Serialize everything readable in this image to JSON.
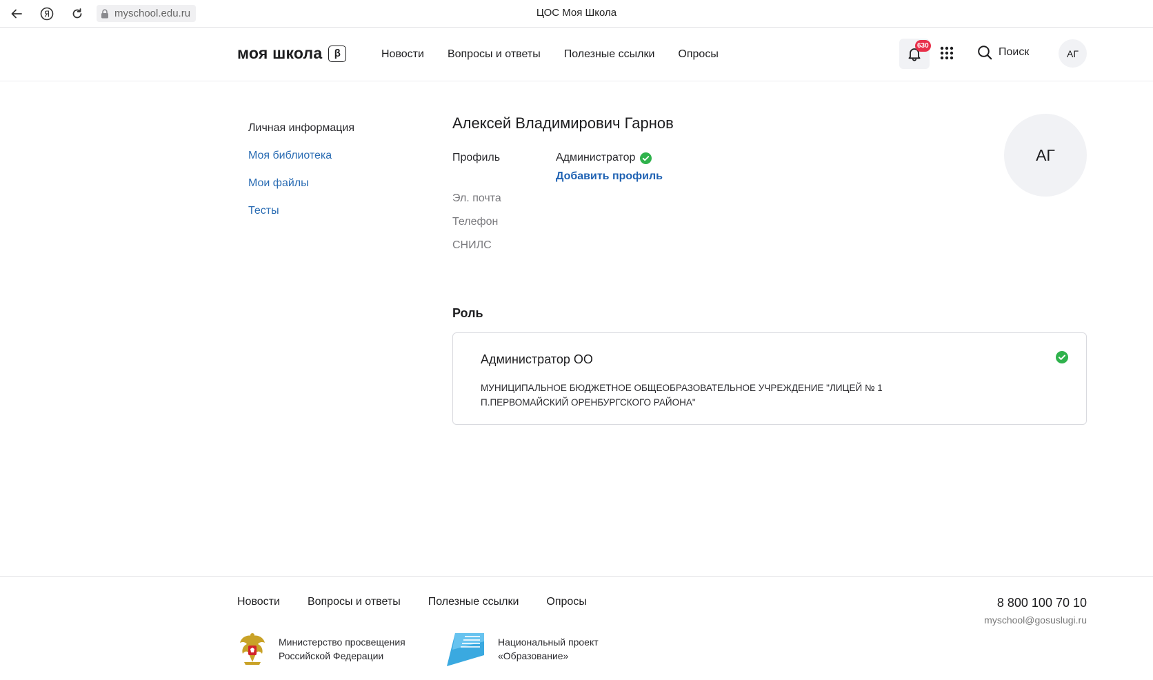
{
  "browser": {
    "url": "myschool.edu.ru",
    "tab_title": "ЦОС Моя Школа"
  },
  "header": {
    "logo": "моя школа",
    "beta": "β",
    "nav": [
      "Новости",
      "Вопросы и ответы",
      "Полезные ссылки",
      "Опросы"
    ],
    "notifications_count": "630",
    "search_label": "Поиск",
    "avatar_initials": "АГ"
  },
  "sidebar": {
    "items": [
      {
        "label": "Личная информация",
        "active": true
      },
      {
        "label": "Моя библиотека",
        "active": false
      },
      {
        "label": "Мои файлы",
        "active": false
      },
      {
        "label": "Тесты",
        "active": false
      }
    ]
  },
  "profile": {
    "full_name": "Алексей Владимирович Гарнов",
    "profile_label": "Профиль",
    "profile_value": "Администратор",
    "add_profile": "Добавить профиль",
    "email_label": "Эл. почта",
    "phone_label": "Телефон",
    "snils_label": "СНИЛС",
    "avatar_initials": "АГ"
  },
  "role": {
    "section_title": "Роль",
    "name": "Администратор ОО",
    "organization": "МУНИЦИПАЛЬНОЕ БЮДЖЕТНОЕ ОБЩЕОБРАЗОВАТЕЛЬНОЕ УЧРЕЖДЕНИЕ \"ЛИЦЕЙ № 1 П.ПЕРВОМАЙСКИЙ ОРЕНБУРГСКОГО РАЙОНА\""
  },
  "footer": {
    "nav": [
      "Новости",
      "Вопросы и ответы",
      "Полезные ссылки",
      "Опросы"
    ],
    "phone": "8 800 100 70 10",
    "email": "myschool@gosuslugi.ru",
    "ministry_line1": "Министерство просвещения",
    "ministry_line2": "Российской Федерации",
    "project_line1": "Национальный проект",
    "project_line2": "«Образование»",
    "project_logo_text": "ОБРАЗОВАНИЕ НАЦИОНАЛЬНЫЕ ПРОЕКТЫ РОССИИ"
  },
  "colors": {
    "link": "#2a6cb3",
    "success": "#2fb24c",
    "badge": "#e8304a"
  }
}
